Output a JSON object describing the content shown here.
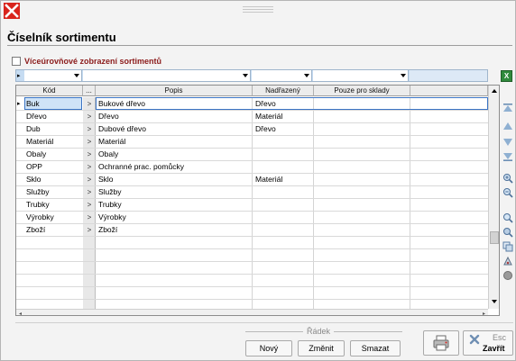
{
  "window": {
    "title": "Číselník sortimentu"
  },
  "options": {
    "multilevel_label": "Víceúrovňové zobrazení sortimentů"
  },
  "grid": {
    "columns": [
      "Kód",
      "...",
      "Popis",
      "Nadřazený",
      "Pouze pro sklady"
    ],
    "rows": [
      {
        "kod": "Buk",
        "popis": "Bukové dřevo",
        "nadrazeny": "Dřevo",
        "pouze": ""
      },
      {
        "kod": "Dřevo",
        "popis": "Dřevo",
        "nadrazeny": "Materiál",
        "pouze": ""
      },
      {
        "kod": "Dub",
        "popis": "Dubové dřevo",
        "nadrazeny": "Dřevo",
        "pouze": ""
      },
      {
        "kod": "Materiál",
        "popis": "Materiál",
        "nadrazeny": "",
        "pouze": ""
      },
      {
        "kod": "Obaly",
        "popis": "Obaly",
        "nadrazeny": "",
        "pouze": ""
      },
      {
        "kod": "OPP",
        "popis": "Ochranné prac. pomůcky",
        "nadrazeny": "",
        "pouze": ""
      },
      {
        "kod": "Sklo",
        "popis": "Sklo",
        "nadrazeny": "Materiál",
        "pouze": ""
      },
      {
        "kod": "Služby",
        "popis": "Služby",
        "nadrazeny": "",
        "pouze": ""
      },
      {
        "kod": "Trubky",
        "popis": "Trubky",
        "nadrazeny": "",
        "pouze": ""
      },
      {
        "kod": "Výrobky",
        "popis": "Výrobky",
        "nadrazeny": "",
        "pouze": ""
      },
      {
        "kod": "Zboží",
        "popis": "Zboží",
        "nadrazeny": "",
        "pouze": ""
      }
    ],
    "row_expander": ">",
    "selected_row": 0
  },
  "footer": {
    "group_label": "Řádek",
    "new_label": "Nový",
    "edit_label": "Změnit",
    "delete_label": "Smazat",
    "close_label": "Zavřít",
    "close_shortcut": "Esc"
  },
  "colors": {
    "close_red": "#d9241c",
    "filter_bar": "#c6dcf2",
    "title_accent": "#8b1a1a",
    "selection": "#cfe3f7"
  },
  "icons": {
    "close": "close-x-icon",
    "excel": "excel-export-icon",
    "print": "print-icon",
    "nav": [
      "first-record-icon",
      "previous-record-icon",
      "next-record-icon",
      "last-record-icon",
      "zoom-in-icon",
      "zoom-out-icon",
      "search-icon",
      "find-next-icon",
      "copy-icon",
      "paint-icon",
      "record-icon"
    ]
  }
}
